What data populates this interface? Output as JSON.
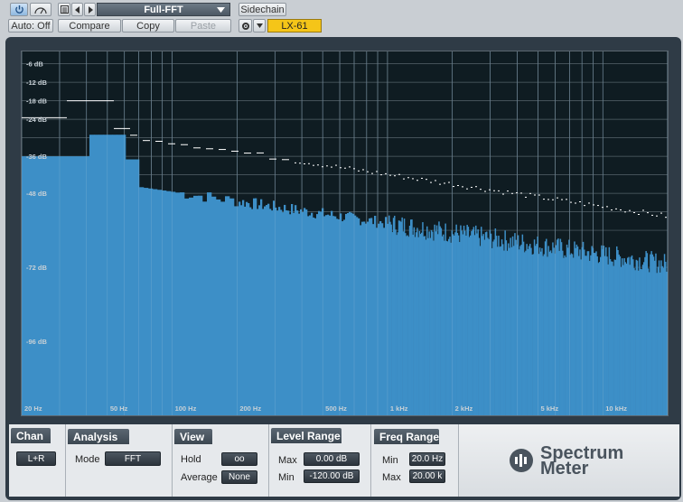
{
  "toolbar": {
    "power_icon": "power-icon",
    "meter_icon": "meter-icon",
    "preset": "Full-FFT",
    "sidechain": "Sidechain",
    "auto": "Auto: Off",
    "compare": "Compare",
    "copy": "Copy",
    "paste": "Paste",
    "device": "LX-61"
  },
  "display": {
    "db_labels": [
      "-6 dB",
      "-12 dB",
      "-18 dB",
      "-24 dB",
      "-36 dB",
      "-48 dB",
      "-72 dB",
      "-96 dB"
    ],
    "hz_labels": [
      "20 Hz",
      "50 Hz",
      "100 Hz",
      "200 Hz",
      "500 Hz",
      "1 kHz",
      "2 kHz",
      "5 kHz",
      "10 kHz"
    ],
    "spectrum_color": "#3d8fc7",
    "peak_color": "#ffffff"
  },
  "panel": {
    "chan": {
      "title": "Chan",
      "value": "L+R"
    },
    "analysis": {
      "title": "Analysis",
      "mode_label": "Mode",
      "mode_value": "FFT"
    },
    "view": {
      "title": "View",
      "hold_label": "Hold",
      "hold_value": "oo",
      "average_label": "Average",
      "average_value": "None"
    },
    "level_range": {
      "title": "Level Range",
      "max_label": "Max",
      "max_value": "0.00 dB",
      "min_label": "Min",
      "min_value": "-120.00 dB"
    },
    "freq_range": {
      "title": "Freq Range",
      "min_label": "Min",
      "min_value": "20.0 Hz",
      "max_label": "Max",
      "max_value": "20.00 k"
    },
    "logo": {
      "line1": "Spectrum",
      "line2": "Meter"
    }
  }
}
